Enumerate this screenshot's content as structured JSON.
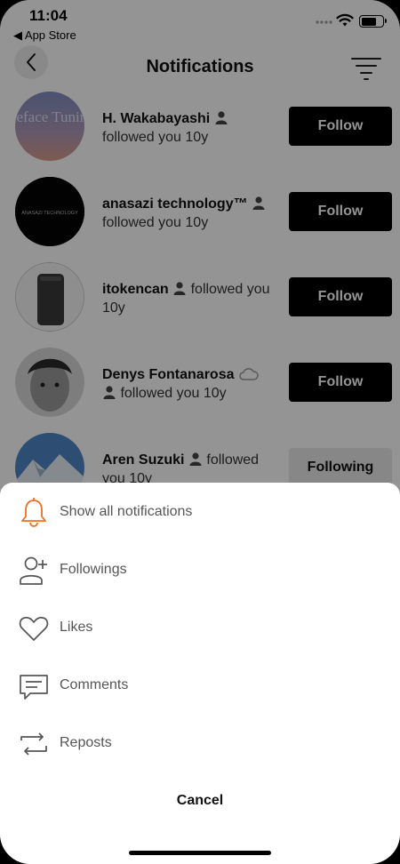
{
  "status_bar": {
    "time": "11:04",
    "back_to_app": "◀ App Store"
  },
  "header": {
    "title": "Notifications"
  },
  "notifications": [
    {
      "name": "H. Wakabayashi",
      "action": "followed you 10y",
      "button": "Follow",
      "following": false
    },
    {
      "name": "anasazi technology™",
      "action": "followed you 10y",
      "button": "Follow",
      "following": false
    },
    {
      "name": "itokencan",
      "action": "followed you 10y",
      "button": "Follow",
      "following": false
    },
    {
      "name": "Denys Fontanarosa",
      "action": "followed you 10y",
      "button": "Follow",
      "following": false
    },
    {
      "name": "Aren Suzuki",
      "action": "followed you 10y",
      "button": "Following",
      "following": true
    }
  ],
  "avatars": {
    "first_text": "Iceface Tuning",
    "second_text": "ANASAZI TECHNOLOGY"
  },
  "sheet": {
    "options": [
      {
        "label": "Show all notifications",
        "icon": "bell-icon",
        "active": true
      },
      {
        "label": "Followings",
        "icon": "person-plus-icon",
        "active": false
      },
      {
        "label": "Likes",
        "icon": "heart-icon",
        "active": false
      },
      {
        "label": "Comments",
        "icon": "comment-icon",
        "active": false
      },
      {
        "label": "Reposts",
        "icon": "repost-icon",
        "active": false
      }
    ],
    "cancel_label": "Cancel"
  },
  "colors": {
    "accent": "#f26f21",
    "button_dark": "#000000",
    "overlay": "rgba(0,0,0,0.42)"
  }
}
